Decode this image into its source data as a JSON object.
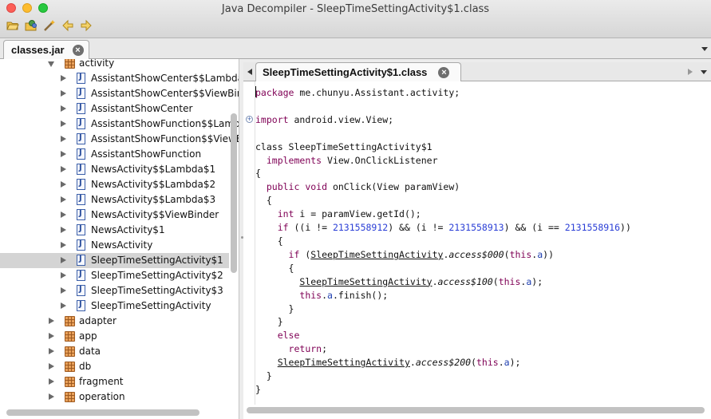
{
  "window": {
    "title": "Java Decompiler - SleepTimeSettingActivity$1.class"
  },
  "toolbar": {
    "icons": [
      "open-folder-icon",
      "open-type-icon",
      "wand-icon",
      "back-arrow-icon",
      "forward-arrow-icon"
    ]
  },
  "outer_tabs": [
    {
      "label": "classes.jar"
    }
  ],
  "tree": {
    "rows": [
      {
        "label": "activity",
        "kind": "package",
        "depth": 1,
        "expanded": true
      },
      {
        "label": "AssistantShowCenter$$Lambda$",
        "kind": "class",
        "depth": 2
      },
      {
        "label": "AssistantShowCenter$$ViewBind",
        "kind": "class",
        "depth": 2
      },
      {
        "label": "AssistantShowCenter",
        "kind": "class",
        "depth": 2
      },
      {
        "label": "AssistantShowFunction$$Lambd",
        "kind": "class",
        "depth": 2
      },
      {
        "label": "AssistantShowFunction$$ViewBi",
        "kind": "class",
        "depth": 2
      },
      {
        "label": "AssistantShowFunction",
        "kind": "class",
        "depth": 2
      },
      {
        "label": "NewsActivity$$Lambda$1",
        "kind": "class",
        "depth": 2
      },
      {
        "label": "NewsActivity$$Lambda$2",
        "kind": "class",
        "depth": 2
      },
      {
        "label": "NewsActivity$$Lambda$3",
        "kind": "class",
        "depth": 2
      },
      {
        "label": "NewsActivity$$ViewBinder",
        "kind": "class",
        "depth": 2
      },
      {
        "label": "NewsActivity$1",
        "kind": "class",
        "depth": 2
      },
      {
        "label": "NewsActivity",
        "kind": "class",
        "depth": 2
      },
      {
        "label": "SleepTimeSettingActivity$1",
        "kind": "class",
        "depth": 2,
        "selected": true
      },
      {
        "label": "SleepTimeSettingActivity$2",
        "kind": "class",
        "depth": 2
      },
      {
        "label": "SleepTimeSettingActivity$3",
        "kind": "class",
        "depth": 2
      },
      {
        "label": "SleepTimeSettingActivity",
        "kind": "class",
        "depth": 2
      },
      {
        "label": "adapter",
        "kind": "package",
        "depth": 1
      },
      {
        "label": "app",
        "kind": "package",
        "depth": 1
      },
      {
        "label": "data",
        "kind": "package",
        "depth": 1
      },
      {
        "label": "db",
        "kind": "package",
        "depth": 1
      },
      {
        "label": "fragment",
        "kind": "package",
        "depth": 1
      },
      {
        "label": "operation",
        "kind": "package",
        "depth": 1
      }
    ]
  },
  "code_tabs": [
    {
      "label": "SleepTimeSettingActivity$1.class"
    }
  ],
  "code": {
    "colors": {
      "keyword": "#7f0055",
      "number": "#2a3ed6",
      "field": "#1f3fb0"
    },
    "lines": [
      [
        [
          "k",
          "package"
        ],
        [
          "t",
          " me.chunyu.Assistant.activity;"
        ]
      ],
      [],
      [
        [
          "k",
          "import"
        ],
        [
          "t",
          " android.view.View;"
        ]
      ],
      [],
      [
        [
          "t",
          "class SleepTimeSettingActivity$1"
        ]
      ],
      [
        [
          "t",
          "  "
        ],
        [
          "k",
          "implements"
        ],
        [
          "t",
          " View.OnClickListener"
        ]
      ],
      [
        [
          "t",
          "{"
        ]
      ],
      [
        [
          "t",
          "  "
        ],
        [
          "k",
          "public void"
        ],
        [
          "t",
          " onClick(View paramView)"
        ]
      ],
      [
        [
          "t",
          "  {"
        ]
      ],
      [
        [
          "t",
          "    "
        ],
        [
          "k",
          "int"
        ],
        [
          "t",
          " i = paramView.getId();"
        ]
      ],
      [
        [
          "t",
          "    "
        ],
        [
          "k",
          "if"
        ],
        [
          "t",
          " ((i != "
        ],
        [
          "n",
          "2131558912"
        ],
        [
          "t",
          ") && (i != "
        ],
        [
          "n",
          "2131558913"
        ],
        [
          "t",
          ") && (i == "
        ],
        [
          "n",
          "2131558916"
        ],
        [
          "t",
          "))"
        ]
      ],
      [
        [
          "t",
          "    {"
        ]
      ],
      [
        [
          "t",
          "      "
        ],
        [
          "k",
          "if"
        ],
        [
          "t",
          " ("
        ],
        [
          "u",
          "SleepTimeSettingActivity"
        ],
        [
          "t",
          "."
        ],
        [
          "i",
          "access$000"
        ],
        [
          "t",
          "("
        ],
        [
          "k",
          "this"
        ],
        [
          "t",
          "."
        ],
        [
          "f",
          "a"
        ],
        [
          "t",
          "))"
        ]
      ],
      [
        [
          "t",
          "      {"
        ]
      ],
      [
        [
          "t",
          "        "
        ],
        [
          "u",
          "SleepTimeSettingActivity"
        ],
        [
          "t",
          "."
        ],
        [
          "i",
          "access$100"
        ],
        [
          "t",
          "("
        ],
        [
          "k",
          "this"
        ],
        [
          "t",
          "."
        ],
        [
          "f",
          "a"
        ],
        [
          "t",
          ");"
        ]
      ],
      [
        [
          "t",
          "        "
        ],
        [
          "k",
          "this"
        ],
        [
          "t",
          "."
        ],
        [
          "f",
          "a"
        ],
        [
          "t",
          ".finish();"
        ]
      ],
      [
        [
          "t",
          "      }"
        ]
      ],
      [
        [
          "t",
          "    }"
        ]
      ],
      [
        [
          "t",
          "    "
        ],
        [
          "k",
          "else"
        ]
      ],
      [
        [
          "t",
          "      "
        ],
        [
          "k",
          "return"
        ],
        [
          "t",
          ";"
        ]
      ],
      [
        [
          "t",
          "    "
        ],
        [
          "u",
          "SleepTimeSettingActivity"
        ],
        [
          "t",
          "."
        ],
        [
          "i",
          "access$200"
        ],
        [
          "t",
          "("
        ],
        [
          "k",
          "this"
        ],
        [
          "t",
          "."
        ],
        [
          "f",
          "a"
        ],
        [
          "t",
          ");"
        ]
      ],
      [
        [
          "t",
          "  }"
        ]
      ],
      [
        [
          "t",
          "}"
        ]
      ]
    ]
  }
}
